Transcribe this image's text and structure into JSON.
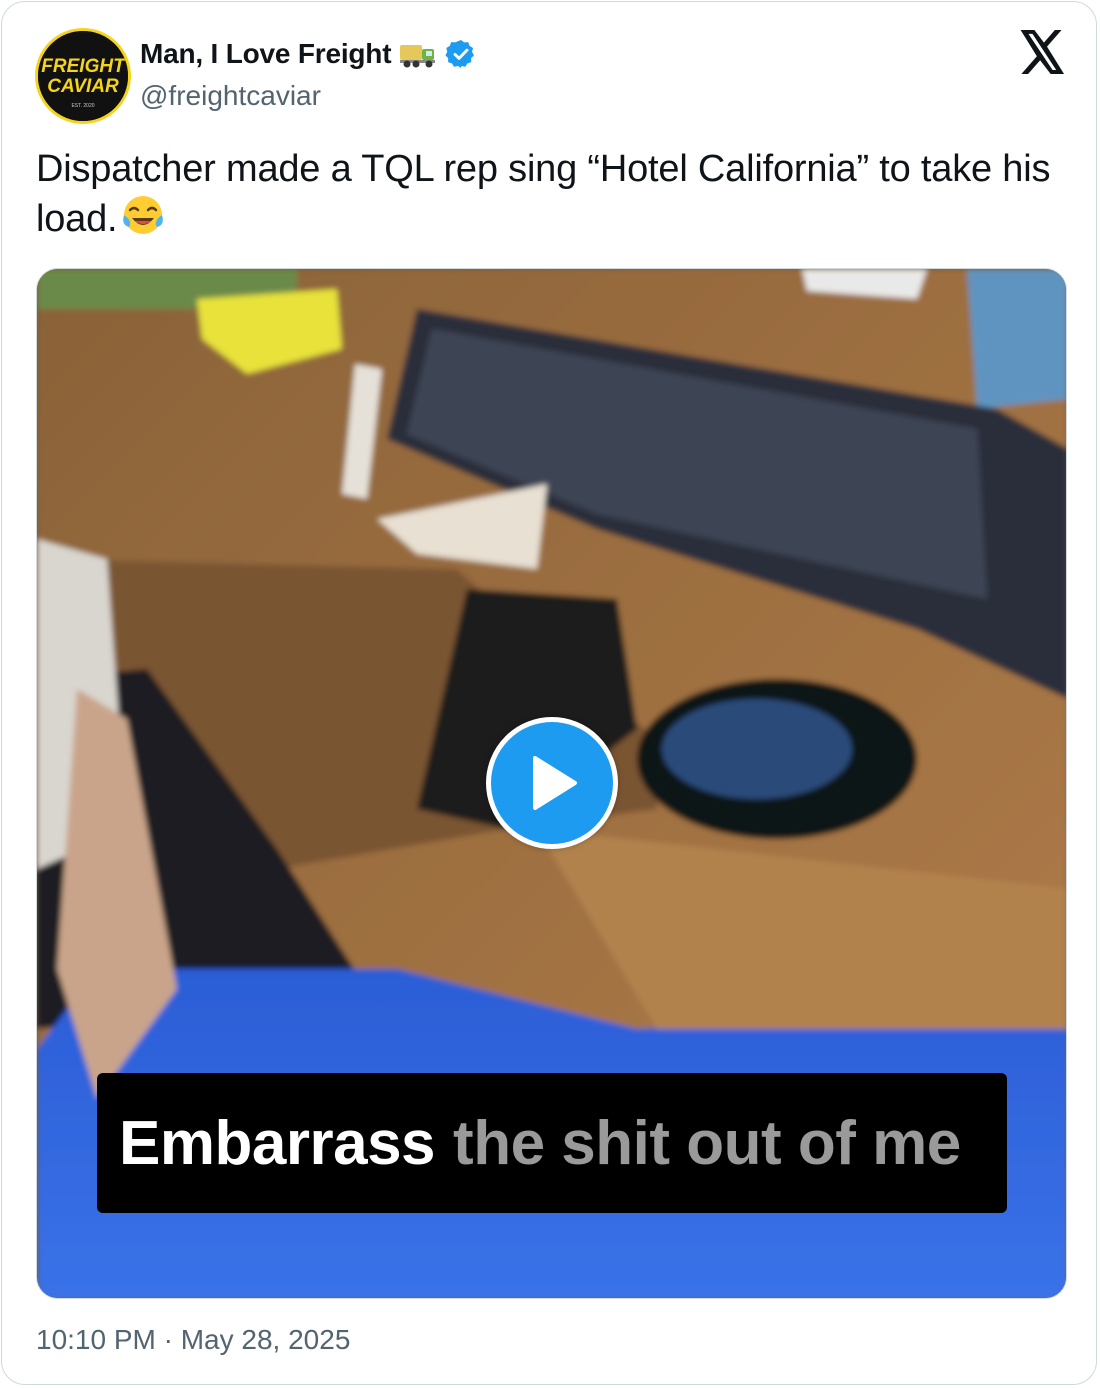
{
  "author": {
    "display_name": "Man, I Love Freight",
    "handle": "@freightcaviar",
    "avatar_text_line1": "FREIGHT",
    "avatar_text_line2": "CAVIAR",
    "avatar_est": "EST. 2020",
    "verified": true,
    "name_emoji": "truck-emoji"
  },
  "platform": {
    "logo": "x-logo-icon"
  },
  "tweet": {
    "text": "Dispatcher made a TQL rep sing “Hotel California” to take his load.",
    "emoji": "face-with-tears-of-joy-emoji",
    "timestamp": "10:10 PM · May 28, 2025"
  },
  "media": {
    "type": "video",
    "caption_highlight": "Embarrass",
    "caption_rest": "the shit out of me",
    "play_icon": "play-icon"
  },
  "colors": {
    "accent": "#1d9bf0",
    "text_primary": "#0f1419",
    "text_secondary": "#536471",
    "border": "#cfd9de",
    "avatar_ring": "#f4d41c"
  }
}
